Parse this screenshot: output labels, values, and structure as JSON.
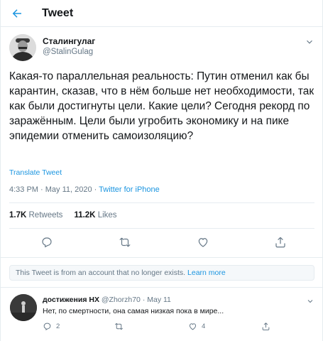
{
  "header": {
    "title": "Tweet"
  },
  "tweet": {
    "author_name": "Сталингулаг",
    "author_handle": "@StalinGulag",
    "text": "Какая-то параллельная реальность: Путин отменил как бы карантин, сказав, что в нём больше нет необходимости, так как были достигнуты цели. Какие цели? Сегодня рекорд по заражённым. Цели были угробить экономику и на пике эпидемии отменить самоизоляцию?",
    "translate_label": "Translate Tweet",
    "time": "4:33 PM · May 11, 2020 · ",
    "source": "Twitter for iPhone",
    "retweets_count": "1.7K",
    "retweets_label": "Retweets",
    "likes_count": "11.2K",
    "likes_label": "Likes"
  },
  "notice": {
    "text": "This Tweet is from an account that no longer exists. ",
    "link": "Learn more"
  },
  "reply": {
    "author_name": "достижения НХ",
    "author_handle": "@Zhorzh70",
    "date": "· May 11",
    "text": "Нет, по смертности, она самая низкая пока в мире...",
    "replies_count": "2",
    "likes_count": "4"
  },
  "icons": {
    "back": "arrow-left-icon",
    "caret": "chevron-down-icon",
    "reply": "reply-icon",
    "retweet": "retweet-icon",
    "like": "heart-icon",
    "share": "share-icon"
  },
  "colors": {
    "accent": "#1b95e0",
    "muted": "#657786",
    "text": "#14171a",
    "border": "#e6ecf0"
  }
}
